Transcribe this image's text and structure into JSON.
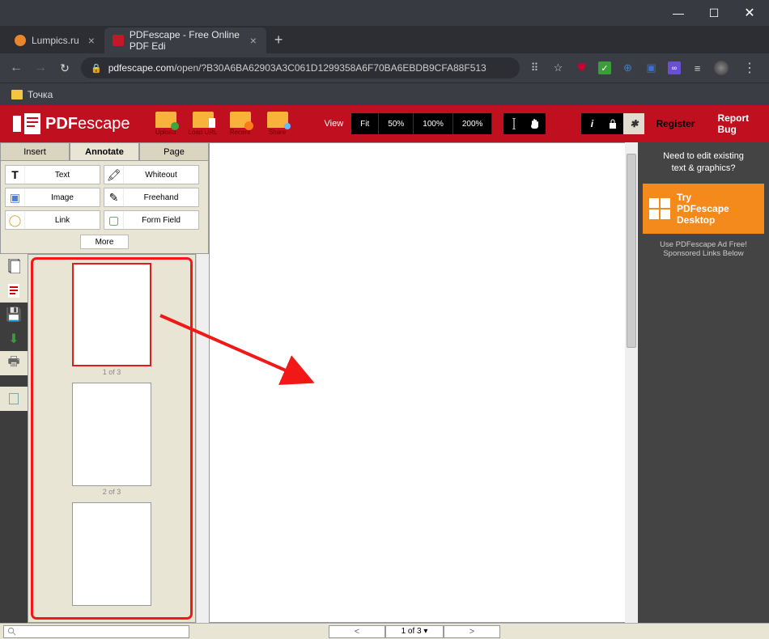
{
  "window": {
    "minimize": "—",
    "maximize": "☐",
    "close": "✕"
  },
  "tabs": [
    {
      "title": "Lumpics.ru",
      "favicon": "#e8862a"
    },
    {
      "title": "PDFescape - Free Online PDF Edi",
      "favicon": "#c41826"
    }
  ],
  "newTab": "+",
  "nav": {
    "back": "←",
    "forward": "→",
    "reload": "↻"
  },
  "url": {
    "domain": "pdfescape.com",
    "path": "/open/?B30A6BA62903A3C061D1299358A6F70BA6EBDB9CFA88F513"
  },
  "bookmark": "Точка",
  "logo": {
    "main": "PDF",
    "sub": "escape"
  },
  "toolbar": {
    "upload": "Upload",
    "loadUrl": "Load URL",
    "recent": "Recent",
    "share": "Share"
  },
  "view": {
    "label": "View",
    "fit": "Fit",
    "z50": "50%",
    "z100": "100%",
    "z200": "200%"
  },
  "topLinks": {
    "register": "Register",
    "reportBug": "Report Bug"
  },
  "tabsPanel": {
    "insert": "Insert",
    "annotate": "Annotate",
    "page": "Page"
  },
  "tools": {
    "text": "Text",
    "whiteout": "Whiteout",
    "image": "Image",
    "freehand": "Freehand",
    "link": "Link",
    "formField": "Form Field",
    "more": "More"
  },
  "thumbs": {
    "p1": "1 of 3",
    "p2": "2 of 3"
  },
  "bottomNav": {
    "prev": "<",
    "next": ">",
    "selector": "1 of 3 ▾"
  },
  "rightPanel": {
    "line1": "Need to edit existing",
    "line2": "text & graphics?",
    "ctaLine1": "Try",
    "ctaLine2": "PDFescape",
    "ctaLine3": "Desktop",
    "sub1": "Use PDFescape Ad Free!",
    "sub2": "Sponsored Links Below"
  }
}
